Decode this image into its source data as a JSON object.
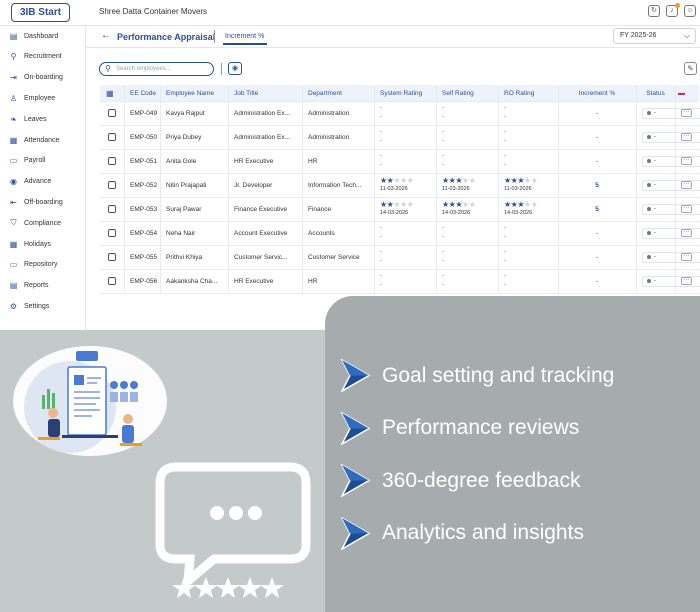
{
  "header": {
    "logo": "3IB Start",
    "company": "Shree Datta Container Movers",
    "icons": [
      "refresh-icon",
      "bell-icon",
      "user-icon"
    ]
  },
  "sidebar": {
    "items": [
      {
        "label": "Dashboard",
        "icon": "dashboard-icon"
      },
      {
        "label": "Recruitment",
        "icon": "search-icon"
      },
      {
        "label": "On-boarding",
        "icon": "login-icon"
      },
      {
        "label": "Employee",
        "icon": "person-icon"
      },
      {
        "label": "Leaves",
        "icon": "leaf-icon"
      },
      {
        "label": "Attendance",
        "icon": "calendar-icon"
      },
      {
        "label": "Payroll",
        "icon": "wallet-icon"
      },
      {
        "label": "Advance",
        "icon": "coin-icon"
      },
      {
        "label": "Off-boarding",
        "icon": "logout-icon"
      },
      {
        "label": "Compliance",
        "icon": "shield-icon"
      },
      {
        "label": "Holidays",
        "icon": "calendar-icon"
      },
      {
        "label": "Repository",
        "icon": "folder-icon"
      },
      {
        "label": "Reports",
        "icon": "report-icon"
      },
      {
        "label": "Settings",
        "icon": "gear-icon"
      }
    ]
  },
  "page": {
    "title": "Performance Appraisal",
    "tab": "Increment %",
    "fy": "FY 2025-26",
    "search_placeholder": "Search employees..."
  },
  "table": {
    "headers": [
      "EE Code",
      "Employee Name",
      "Job Title",
      "Department",
      "System Rating",
      "Self Rating",
      "RO Rating",
      "Increment %",
      "Status"
    ],
    "rows": [
      {
        "code": "EMP-049",
        "name": "Kavya Rajput",
        "job": "Administration Ex...",
        "dept": "Administration",
        "sys": null,
        "self": null,
        "ro": null,
        "inc": "-",
        "status": "-"
      },
      {
        "code": "EMP-050",
        "name": "Priya Dubey",
        "job": "Administration Ex...",
        "dept": "Administration",
        "sys": null,
        "self": null,
        "ro": null,
        "inc": "-",
        "status": "-"
      },
      {
        "code": "EMP-051",
        "name": "Anita Gole",
        "job": "HR Executive",
        "dept": "HR",
        "sys": null,
        "self": null,
        "ro": null,
        "inc": "-",
        "status": "-"
      },
      {
        "code": "EMP-052",
        "name": "Nitin Prajapati",
        "job": "Jr. Developer",
        "dept": "Information Tech...",
        "sys": {
          "stars": 2,
          "date": "11-03-2026"
        },
        "self": {
          "stars": 3,
          "date": "11-03-2026"
        },
        "ro": {
          "stars": 3,
          "date": "11-03-2026"
        },
        "inc": "5",
        "status": "-"
      },
      {
        "code": "EMP-053",
        "name": "Suraj Pawar",
        "job": "Finance Executive",
        "dept": "Finance",
        "sys": {
          "stars": 2,
          "date": "14-03-2026"
        },
        "self": {
          "stars": 3,
          "date": "14-03-2026"
        },
        "ro": {
          "stars": 3,
          "date": "14-03-2026"
        },
        "inc": "5",
        "status": "-"
      },
      {
        "code": "EMP-054",
        "name": "Neha Nair",
        "job": "Account Executive",
        "dept": "Accounts",
        "sys": null,
        "self": null,
        "ro": null,
        "inc": "-",
        "status": "-"
      },
      {
        "code": "EMP-055",
        "name": "Prithvi Khiya",
        "job": "Customer Servic...",
        "dept": "Customer Service",
        "sys": null,
        "self": null,
        "ro": null,
        "inc": "-",
        "status": "-"
      },
      {
        "code": "EMP-056",
        "name": "Aakanksha Cha...",
        "job": "HR Executive",
        "dept": "HR",
        "sys": null,
        "self": null,
        "ro": null,
        "inc": "-",
        "status": "-"
      }
    ]
  },
  "features": [
    "Goal setting and tracking",
    "Performance reviews",
    "360-degree feedback",
    "Analytics and insights"
  ],
  "colors": {
    "brand": "#2a4f98",
    "accent": "#f29b1d",
    "panel": "#a6acae",
    "background": "#c4c9ca"
  }
}
